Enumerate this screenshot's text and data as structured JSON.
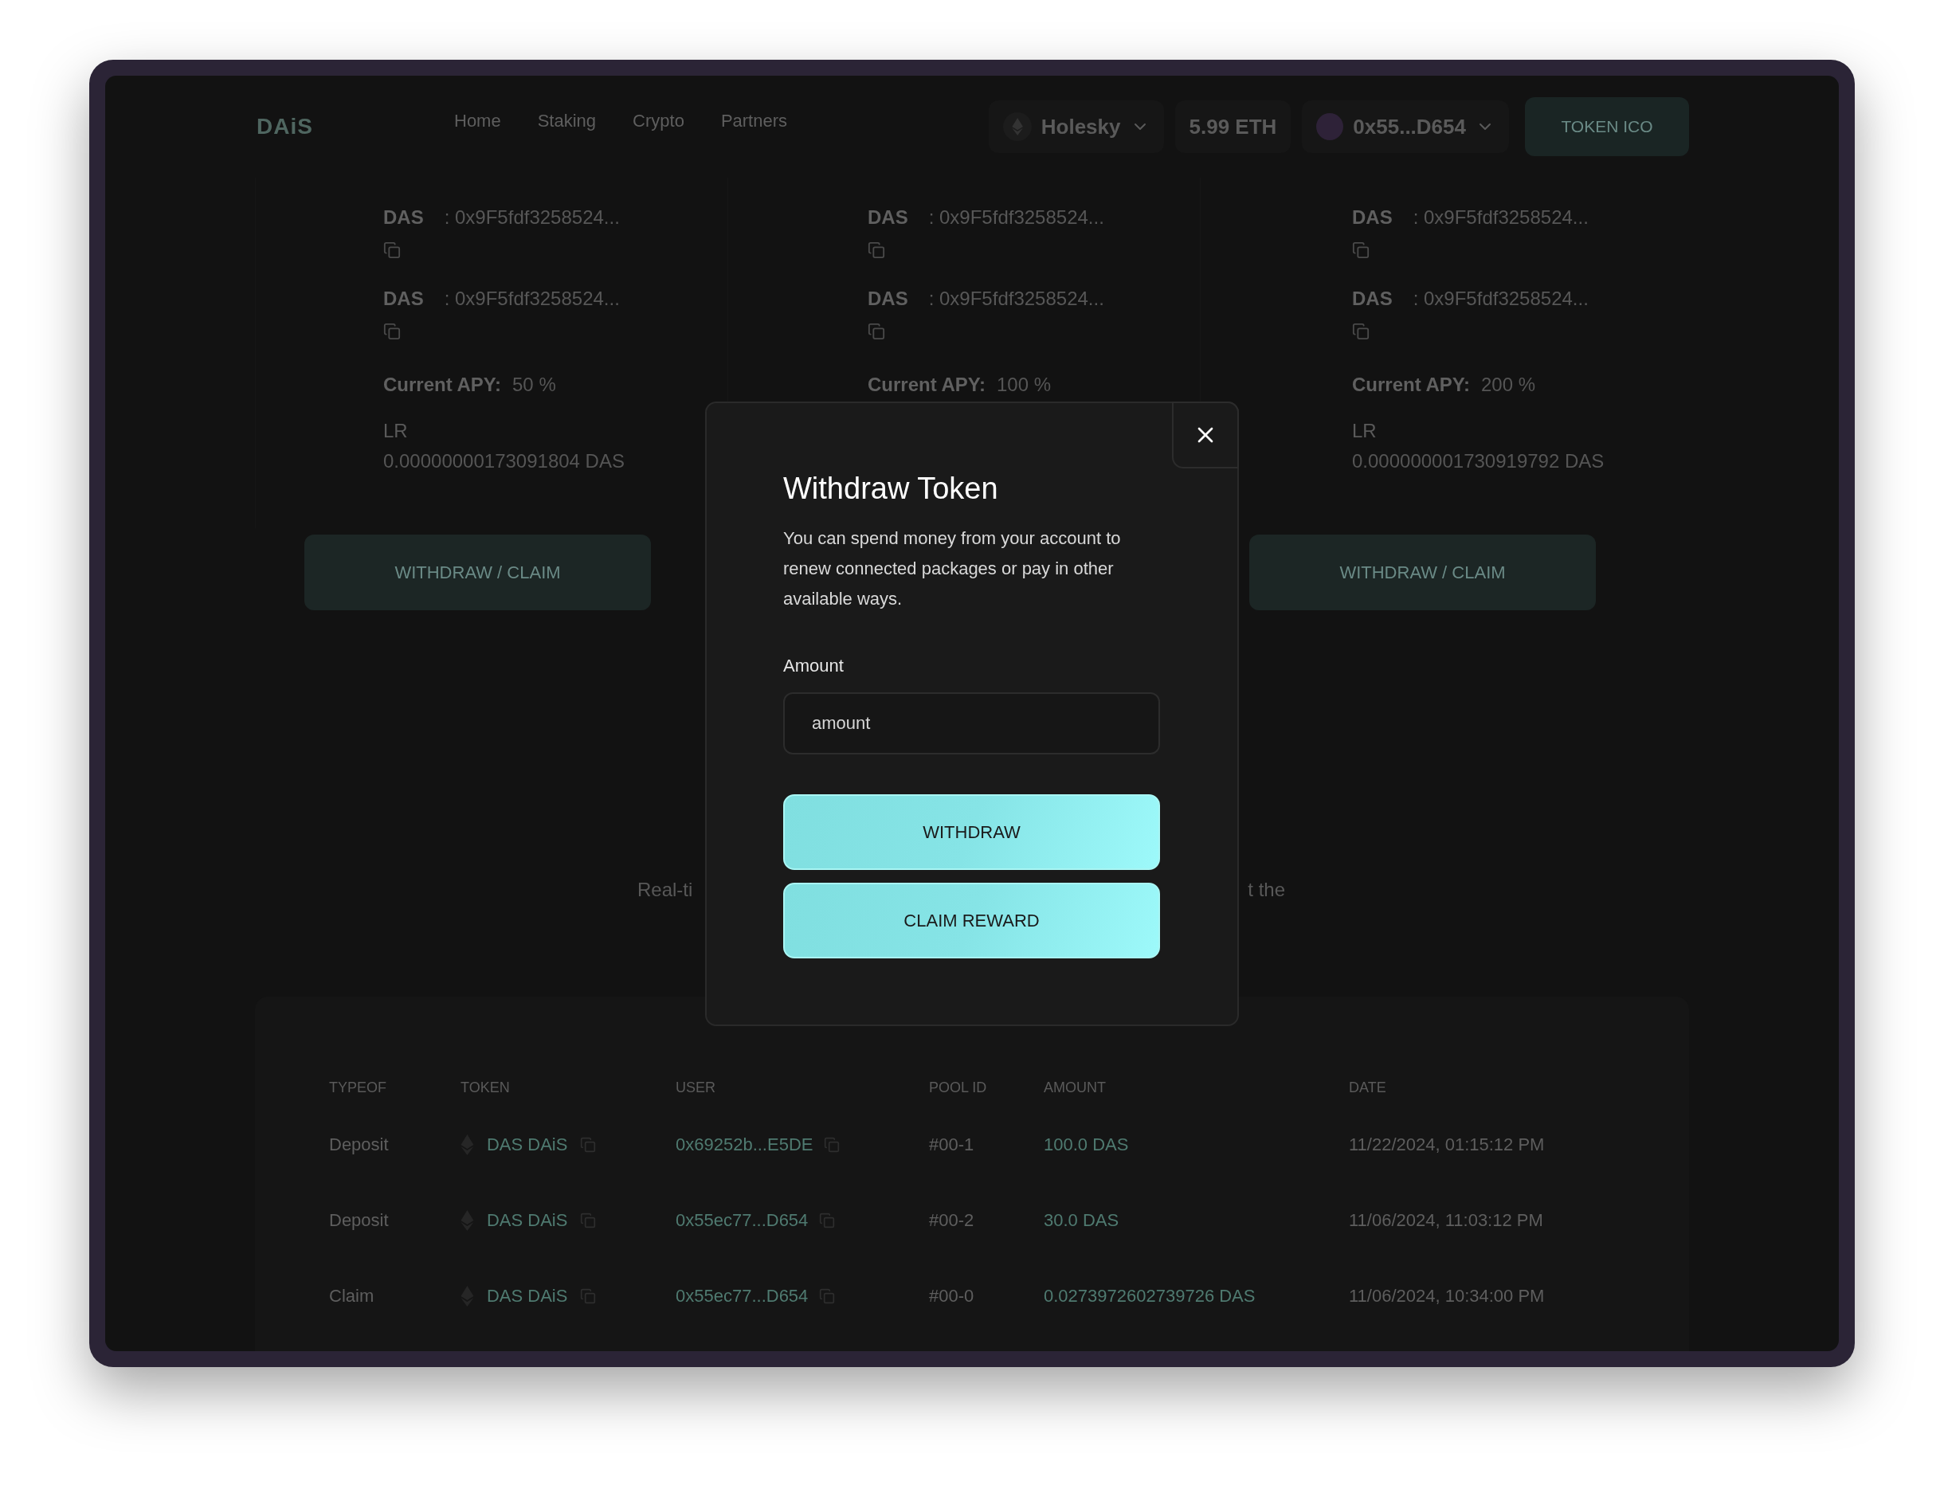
{
  "header": {
    "logo": "DAiS",
    "nav": [
      {
        "label": "Home"
      },
      {
        "label": "Staking"
      },
      {
        "label": "Crypto"
      },
      {
        "label": "Partners"
      }
    ],
    "network": "Holesky",
    "balance": "5.99 ETH",
    "account": "0x55...D654",
    "cta": "TOKEN ICO"
  },
  "pools": [
    {
      "tokens": [
        {
          "symbol": "DAS",
          "address": ": 0x9F5fdf3258524..."
        },
        {
          "symbol": "DAS",
          "address": ": 0x9F5fdf3258524..."
        }
      ],
      "apy_label": "Current APY:",
      "apy": "50 %",
      "lr_label": "LR",
      "lr_value": "0.00000000173091804 DAS",
      "button": "WITHDRAW / CLAIM"
    },
    {
      "tokens": [
        {
          "symbol": "DAS",
          "address": ": 0x9F5fdf3258524..."
        },
        {
          "symbol": "DAS",
          "address": ": 0x9F5fdf3258524..."
        }
      ],
      "apy_label": "Current APY:",
      "apy": "100 %"
    },
    {
      "tokens": [
        {
          "symbol": "DAS",
          "address": ": 0x9F5fdf3258524..."
        },
        {
          "symbol": "DAS",
          "address": ": 0x9F5fdf3258524..."
        }
      ],
      "apy_label": "Current APY:",
      "apy": "200 %",
      "lr_label": "LR",
      "lr_value": "0.000000001730919792 DAS",
      "button": "WITHDRAW / CLAIM"
    }
  ],
  "intro_fragments": [
    "Real-ti",
    "t the"
  ],
  "history": {
    "columns": [
      "TYPEOF",
      "TOKEN",
      "USER",
      "POOL ID",
      "AMOUNT",
      "DATE"
    ],
    "rows": [
      {
        "type": "Deposit",
        "token": "DAS DAiS",
        "user": "0x69252b...E5DE",
        "pool_id": "#00-1",
        "amount": "100.0 DAS",
        "date": "11/22/2024, 01:15:12 PM"
      },
      {
        "type": "Deposit",
        "token": "DAS DAiS",
        "user": "0x55ec77...D654",
        "pool_id": "#00-2",
        "amount": "30.0 DAS",
        "date": "11/06/2024, 11:03:12 PM"
      },
      {
        "type": "Claim",
        "token": "DAS DAiS",
        "user": "0x55ec77...D654",
        "pool_id": "#00-0",
        "amount": "0.0273972602739726 DAS",
        "date": "11/06/2024, 10:34:00 PM"
      }
    ]
  },
  "modal": {
    "title": "Withdraw Token",
    "description": "You can spend money from your account to renew connected packages or pay in other available ways.",
    "amount_label": "Amount",
    "amount_placeholder": "amount",
    "buttons": [
      "WITHDRAW",
      "CLAIM REWARD"
    ]
  }
}
